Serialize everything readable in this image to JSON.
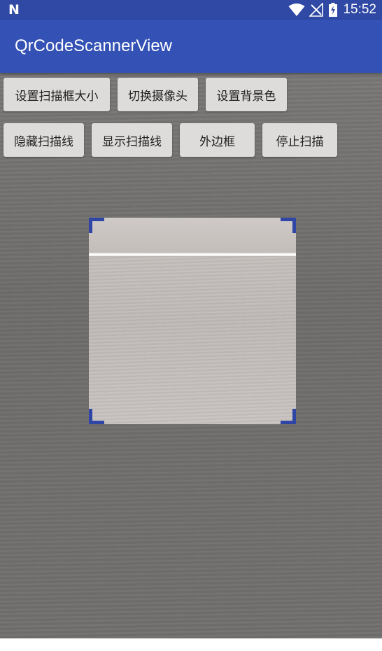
{
  "status_bar": {
    "notification_icon": "N",
    "time": "15:52",
    "icons": [
      "wifi-icon",
      "signal-icon",
      "battery-icon"
    ]
  },
  "app_bar": {
    "title": "QrCodeScannerView"
  },
  "buttons_row1": [
    {
      "label": "设置扫描框大小"
    },
    {
      "label": "切换摄像头"
    },
    {
      "label": "设置背景色"
    }
  ],
  "buttons_row2": [
    {
      "label": "隐藏扫描线"
    },
    {
      "label": "显示扫描线"
    },
    {
      "label": "外边框"
    },
    {
      "label": "停止扫描"
    }
  ],
  "colors": {
    "status_bar": "#2f49a5",
    "app_bar": "#3451b5",
    "scan_corner": "#2f46a6",
    "button_bg": "#dedcda"
  }
}
